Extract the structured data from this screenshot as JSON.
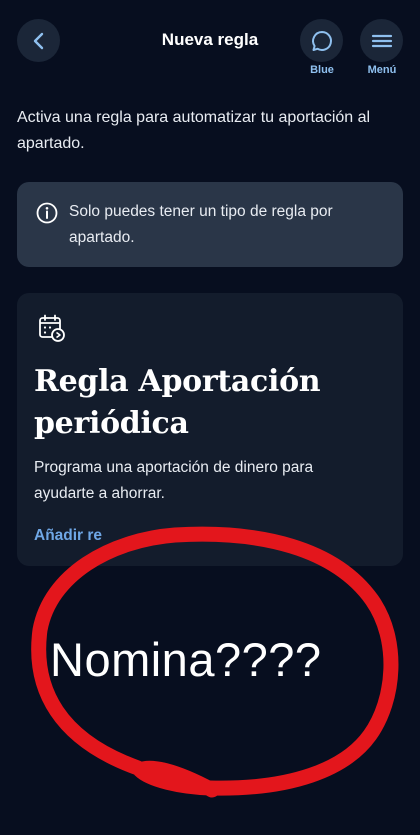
{
  "header": {
    "title": "Nueva regla",
    "blue_label": "Blue",
    "menu_label": "Menú"
  },
  "intro_text": "Activa una regla para automatizar tu aportación al apartado.",
  "info": {
    "text": "Solo puedes tener un tipo de regla por apartado.",
    "icon": "info-icon"
  },
  "rule_card": {
    "icon": "calendar-icon",
    "title": "Regla Aportación periódica",
    "description": "Programa una aportación de dinero para ayudarte a ahorrar.",
    "link_label": "Añadir re"
  },
  "annotation": {
    "text": "Nomina????",
    "color": "#e3161c"
  },
  "colors": {
    "background": "#070e1f",
    "accent": "#6fa7e6",
    "caption": "#8fc0ef"
  }
}
